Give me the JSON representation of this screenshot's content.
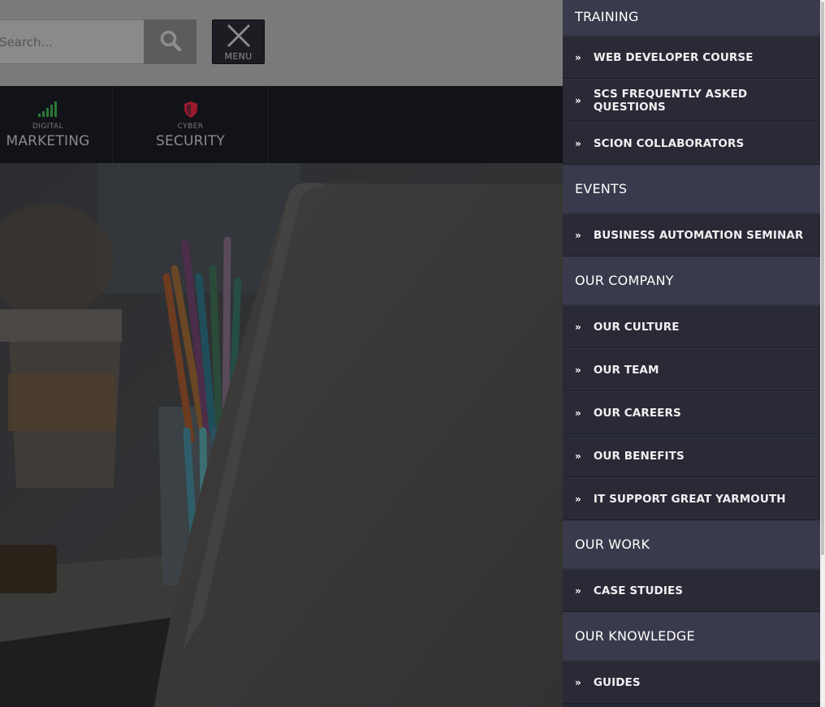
{
  "header": {
    "search_placeholder": "Search...",
    "menu_label": "MENU"
  },
  "categories": [
    {
      "small": "DIGITAL",
      "big": "MARKETING",
      "icon": "signal-bars-icon",
      "icon_color": "#2e8b3a"
    },
    {
      "small": "CYBER",
      "big": "SECURITY",
      "icon": "shield-icon",
      "icon_color": "#c0213a"
    }
  ],
  "drawer": {
    "sections": [
      {
        "title": "TRAINING",
        "items": [
          "WEB DEVELOPER COURSE",
          "SCS FREQUENTLY ASKED QUESTIONS",
          "SCION COLLABORATORS"
        ]
      },
      {
        "title": "EVENTS",
        "items": [
          "BUSINESS AUTOMATION SEMINAR"
        ]
      },
      {
        "title": "OUR COMPANY",
        "items": [
          "OUR CULTURE",
          "OUR TEAM",
          "OUR CAREERS",
          "OUR BENEFITS",
          "IT SUPPORT GREAT YARMOUTH"
        ]
      },
      {
        "title": "OUR WORK",
        "items": [
          "CASE STUDIES"
        ]
      },
      {
        "title": "OUR KNOWLEDGE",
        "items": [
          "GUIDES"
        ]
      }
    ],
    "bullet": "»"
  },
  "colors": {
    "drawer_bg": "#262733",
    "section_bg": "#393a4b",
    "overlay": "#000000"
  }
}
